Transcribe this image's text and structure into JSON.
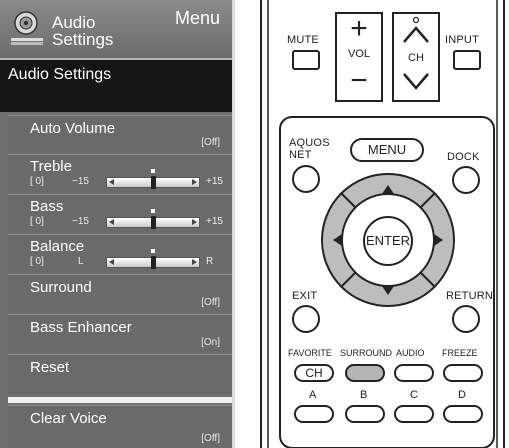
{
  "menu": {
    "header_title_line1": "Audio",
    "header_title_line2": "Settings",
    "header_menu_label": "Menu",
    "section_title": "Audio Settings",
    "items": [
      {
        "label": "Auto Volume",
        "value": "[Off]"
      },
      {
        "label": "Treble",
        "level": "[  0]",
        "min": "−15",
        "max": "+15",
        "position": 0.5
      },
      {
        "label": "Bass",
        "level": "[  0]",
        "min": "−15",
        "max": "+15",
        "position": 0.5
      },
      {
        "label": "Balance",
        "level": "[  0]",
        "min": "L",
        "max": "R",
        "position": 0.5
      },
      {
        "label": "Surround",
        "value": "[Off]"
      },
      {
        "label": "Bass Enhancer",
        "value": "[On]"
      },
      {
        "label": "Reset"
      },
      {
        "label": "Clear Voice",
        "value": "[Off]"
      }
    ]
  },
  "remote": {
    "mute_label": "MUTE",
    "vol_label": "VOL",
    "vol_plus": "+",
    "vol_minus": "−",
    "ch_label": "CH",
    "input_label": "INPUT",
    "aquos_net_line1": "AQUOS",
    "aquos_net_line2": "NET",
    "menu_label": "MENU",
    "dock_label": "DOCK",
    "enter_label": "ENTER",
    "exit_label": "EXIT",
    "return_label": "RETURN",
    "favorite_label": "FAVORITE",
    "surround_label": "SURROUND",
    "audio_label": "AUDIO",
    "freeze_label": "FREEZE",
    "ch_button_label": "CH",
    "a_label": "A",
    "b_label": "B",
    "c_label": "C",
    "d_label": "D"
  }
}
